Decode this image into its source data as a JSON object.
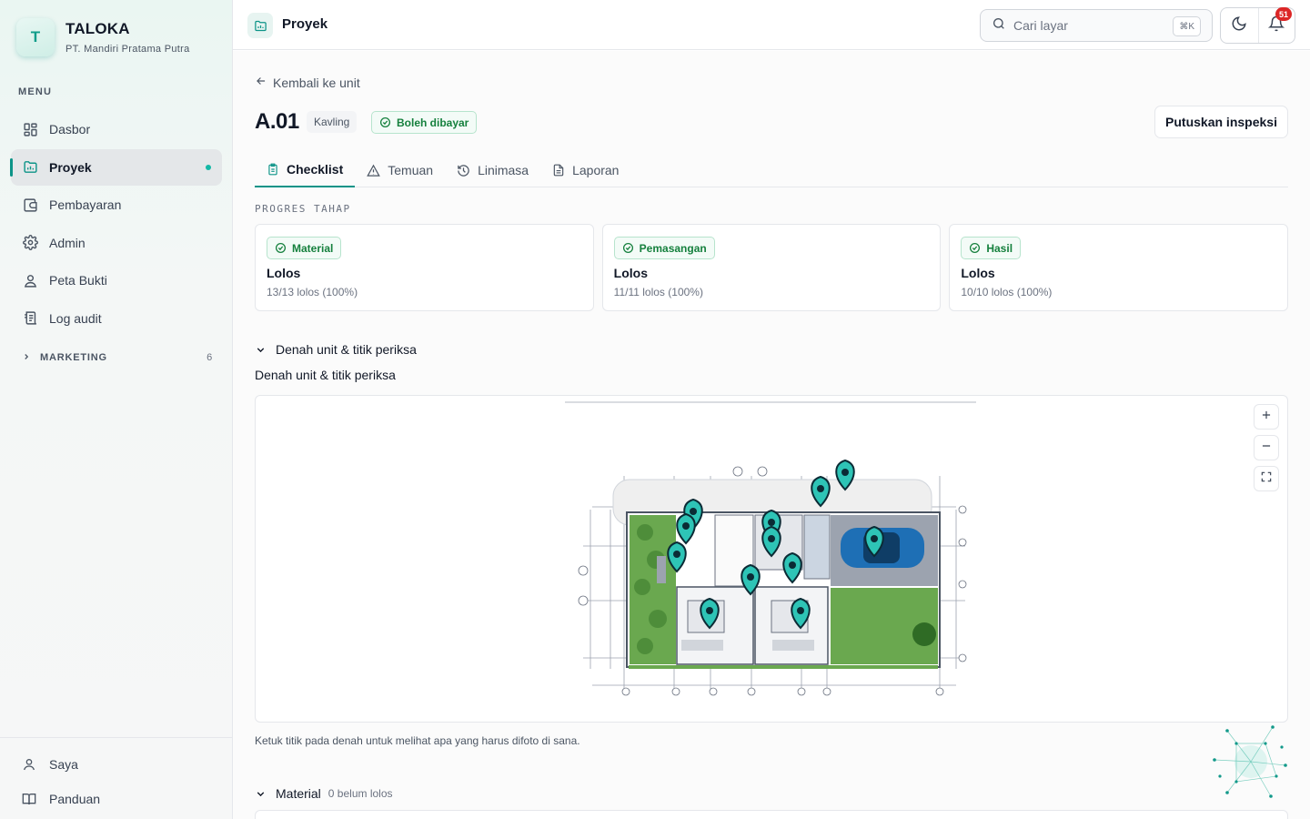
{
  "brand": {
    "logo_letter": "T",
    "name": "TALOKA",
    "company": "PT. Mandiri Pratama Putra"
  },
  "sidebar": {
    "menu_heading": "MENU",
    "items": [
      {
        "label": "Dasbor",
        "icon": "dashboard-icon"
      },
      {
        "label": "Proyek",
        "icon": "folder-icon",
        "active": true
      },
      {
        "label": "Pembayaran",
        "icon": "wallet-icon"
      },
      {
        "label": "Admin",
        "icon": "gear-icon"
      },
      {
        "label": "Peta Bukti",
        "icon": "map-pin-user-icon"
      },
      {
        "label": "Log audit",
        "icon": "log-icon"
      }
    ],
    "marketing": {
      "label": "MARKETING",
      "count": "6"
    },
    "footer": [
      {
        "label": "Saya",
        "icon": "user-icon"
      },
      {
        "label": "Panduan",
        "icon": "book-icon"
      }
    ]
  },
  "topbar": {
    "title": "Proyek",
    "search_placeholder": "Cari layar",
    "search_shortcut": "⌘K",
    "notification_count": "51"
  },
  "main": {
    "back_label": "Kembali ke unit",
    "unit_title": "A.01",
    "unit_type": "Kavling",
    "payment_status": "Boleh dibayar",
    "decide_button": "Putuskan inspeksi",
    "tabs": [
      {
        "label": "Checklist",
        "icon": "clipboard-icon",
        "active": true
      },
      {
        "label": "Temuan",
        "icon": "warning-icon"
      },
      {
        "label": "Linimasa",
        "icon": "history-icon"
      },
      {
        "label": "Laporan",
        "icon": "document-icon"
      }
    ],
    "progress_heading": "PROGRES TAHAP",
    "stages": [
      {
        "name": "Material",
        "status": "Lolos",
        "detail": "13/13 lolos (100%)"
      },
      {
        "name": "Pemasangan",
        "status": "Lolos",
        "detail": "11/11 lolos (100%)"
      },
      {
        "name": "Hasil",
        "status": "Lolos",
        "detail": "10/10 lolos (100%)"
      }
    ],
    "floorplan_section": "Denah unit & titik periksa",
    "floorplan_title": "Denah unit & titik periksa",
    "floorplan_hint": "Ketuk titik pada denah untuk melihat apa yang harus difoto di sana.",
    "material_section": "Material",
    "material_count": "0 belum lolos"
  },
  "colors": {
    "accent": "#0d9488",
    "pin": "#2ec4b6",
    "success": "#15803d",
    "badge": "#dc2626"
  }
}
